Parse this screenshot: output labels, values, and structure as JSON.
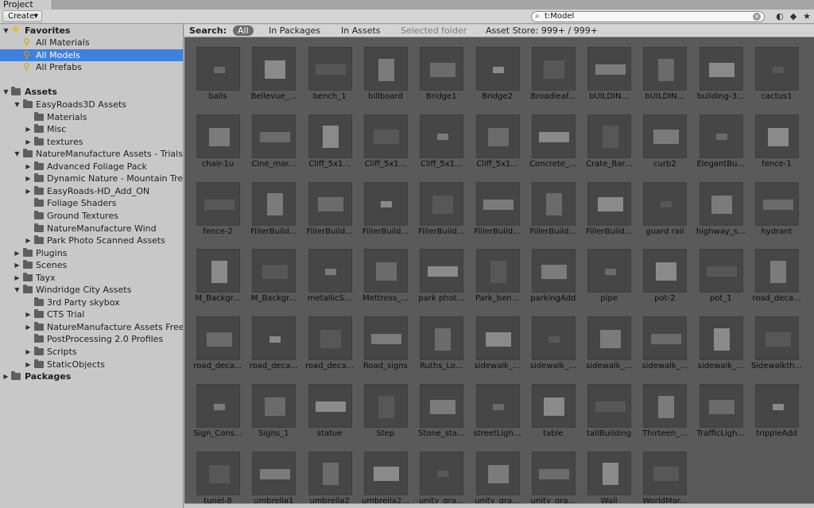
{
  "window": {
    "tab_title": "Project"
  },
  "toolbar": {
    "create_label": "Create",
    "search_value": "t:Model"
  },
  "favorites": {
    "header": "Favorites",
    "items": [
      {
        "label": "All Materials",
        "selected": false
      },
      {
        "label": "All Models",
        "selected": true
      },
      {
        "label": "All Prefabs",
        "selected": false
      }
    ]
  },
  "assets": {
    "header": "Assets",
    "tree": [
      {
        "label": "EasyRoads3D Assets",
        "depth": 1,
        "expanded": true
      },
      {
        "label": "Materials",
        "depth": 2,
        "expanded": null
      },
      {
        "label": "Misc",
        "depth": 2,
        "expanded": false
      },
      {
        "label": "textures",
        "depth": 2,
        "expanded": false
      },
      {
        "label": "NatureManufacture Assets - Trials",
        "depth": 1,
        "expanded": true
      },
      {
        "label": "Advanced Foliage Pack",
        "depth": 2,
        "expanded": false
      },
      {
        "label": "Dynamic Nature - Mountain Tre",
        "depth": 2,
        "expanded": false
      },
      {
        "label": "EasyRoads-HD_Add_ON",
        "depth": 2,
        "expanded": false
      },
      {
        "label": "Foliage Shaders",
        "depth": 2,
        "expanded": null
      },
      {
        "label": "Ground Textures",
        "depth": 2,
        "expanded": null
      },
      {
        "label": "NatureManufacture Wind",
        "depth": 2,
        "expanded": null
      },
      {
        "label": "Park Photo Scanned Assets",
        "depth": 2,
        "expanded": false
      },
      {
        "label": "Plugins",
        "depth": 1,
        "expanded": false
      },
      {
        "label": "Scenes",
        "depth": 1,
        "expanded": false
      },
      {
        "label": "Tayx",
        "depth": 1,
        "expanded": false
      },
      {
        "label": "Windridge City Assets",
        "depth": 1,
        "expanded": true
      },
      {
        "label": "3rd Party skybox",
        "depth": 2,
        "expanded": null
      },
      {
        "label": "CTS Trial",
        "depth": 2,
        "expanded": false
      },
      {
        "label": "NatureManufacture Assets Free",
        "depth": 2,
        "expanded": false
      },
      {
        "label": "PostProcessing 2.0 Profiles",
        "depth": 2,
        "expanded": null
      },
      {
        "label": "Scripts",
        "depth": 2,
        "expanded": false
      },
      {
        "label": "StaticObjects",
        "depth": 2,
        "expanded": false
      }
    ]
  },
  "packages": {
    "header": "Packages"
  },
  "search_bar": {
    "label": "Search:",
    "scopes": [
      "All",
      "In Packages",
      "In Assets",
      "Selected folder",
      "Asset Store: 999+ / 999+"
    ]
  },
  "assets_grid": [
    "balls",
    "Bellevue_...",
    "bench_1",
    "billboard",
    "Bridge1",
    "Bridge2",
    "Broadleaf...",
    "bUILDIN...",
    "bUILDIN...",
    "building-3...",
    "cactus1",
    "chair-1u",
    "Cine_mar...",
    "Cliff_5x1...",
    "Cliff_5x1...",
    "Cliff_5x1...",
    "Cliff_5x1...",
    "Concrete_...",
    "Crate_Bar...",
    "curb2",
    "ElegantBu...",
    "fence-1",
    "fence-2",
    "FillerBuild...",
    "FillerBuild...",
    "FillerBuild...",
    "FillerBuild...",
    "FillerBuild...",
    "FillerBuild...",
    "FillerBuild...",
    "guard rail",
    "highway_s...",
    "hydrant",
    "M_Backgr...",
    "M_Backgr...",
    "metallicS...",
    "Mettress_...",
    "park phot...",
    "Park_ben...",
    "parkingAdd",
    "pipe",
    "pot-2",
    "pot_1",
    "road_deca...",
    "road_deca...",
    "road_deca...",
    "road_deca...",
    "Road_signs",
    "Ruths_Lo...",
    "sidewalk_...",
    "sidewalk_...",
    "sidewalk_...",
    "sidewalk_...",
    "sidewalk_...",
    "Sidewalkth...",
    "Sign_Cons...",
    "Signs_1",
    "statue",
    "Step",
    "Stone_sta...",
    "streetLigh...",
    "table",
    "tallBuilding",
    "Thirteen_...",
    "TrafficLigh...",
    "trippleAdd",
    "tunel-8",
    "umbrella1",
    "umbrella2",
    "umbrella2...",
    "unity_gra...",
    "unity_gra...",
    "unity_gra...",
    "Wall",
    "WorldMar..."
  ]
}
